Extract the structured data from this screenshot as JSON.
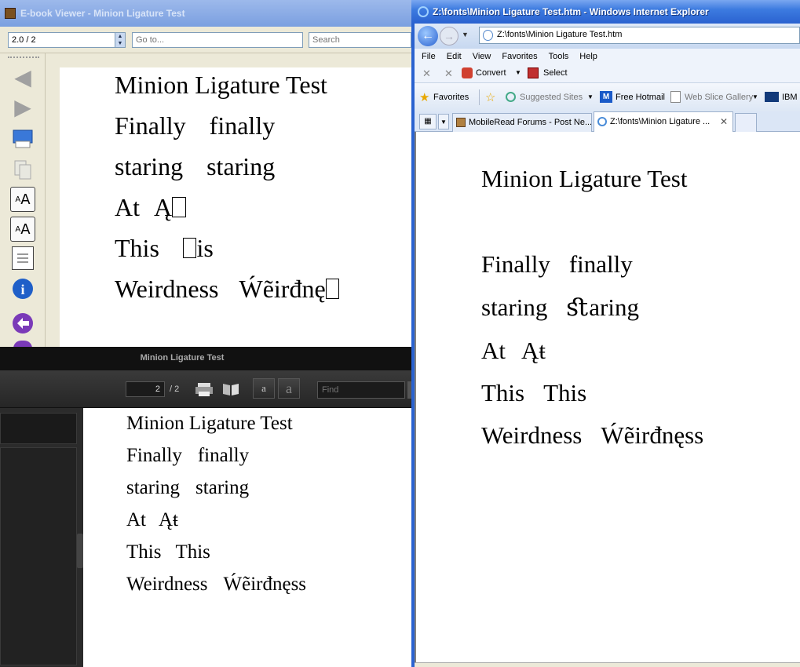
{
  "viewer": {
    "title": "E-book Viewer - Minion Ligature Test",
    "page_field": "2.0 / 2",
    "goto_placeholder": "Go to...",
    "search_placeholder": "Search",
    "lines": [
      {
        "left": "Minion Ligature Test",
        "right": ""
      },
      {
        "left": "Finally",
        "right": "finally"
      },
      {
        "left": "staring",
        "right": "staring"
      },
      {
        "left": "At",
        "right": "Ą"
      },
      {
        "left": "This",
        "right": "is"
      },
      {
        "left": "Weirdness",
        "right": "Ẃẽirđnę"
      }
    ]
  },
  "adobe": {
    "title": "Minion Ligature Test",
    "page_current": "2",
    "page_total": "/ 2",
    "find_placeholder": "Find",
    "font_small": "a",
    "font_large": "a",
    "lines": [
      {
        "left": "Minion Ligature Test",
        "right": ""
      },
      {
        "left": "Finally",
        "right": "finally"
      },
      {
        "left": "staring",
        "right": "staring"
      },
      {
        "left": "At",
        "right": "Ąŧ"
      },
      {
        "left": "This",
        "right": "This"
      },
      {
        "left": "Weirdness",
        "right": "Ẃẽirđnęss"
      }
    ]
  },
  "ie": {
    "title": "Z:\\fonts\\Minion Ligature Test.htm - Windows Internet Explorer",
    "address": "Z:\\fonts\\Minion Ligature Test.htm",
    "menu": [
      "File",
      "Edit",
      "View",
      "Favorites",
      "Tools",
      "Help"
    ],
    "convert": "Convert",
    "select": "Select",
    "favorites": "Favorites",
    "suggested_sites": "Suggested Sites",
    "free_hotmail": "Free Hotmail",
    "web_slice": "Web Slice Gallery",
    "ibm": "IBM i",
    "tabs": [
      "MobileRead Forums - Post Ne...",
      "Z:\\fonts\\Minion Ligature ..."
    ],
    "lines": [
      {
        "left": "Minion Ligature Test",
        "right": ""
      },
      {
        "left": "Finally",
        "right": "finally"
      },
      {
        "left": "staring",
        "right": "ﬆaring"
      },
      {
        "left": "At",
        "right": "Ąŧ"
      },
      {
        "left": "This",
        "right": "This"
      },
      {
        "left": "Weirdness",
        "right": "Ẃẽirđnęss"
      }
    ]
  },
  "colors": {
    "xp_blue": "#2a62d0",
    "adobe_dark": "#2b2b2b"
  }
}
